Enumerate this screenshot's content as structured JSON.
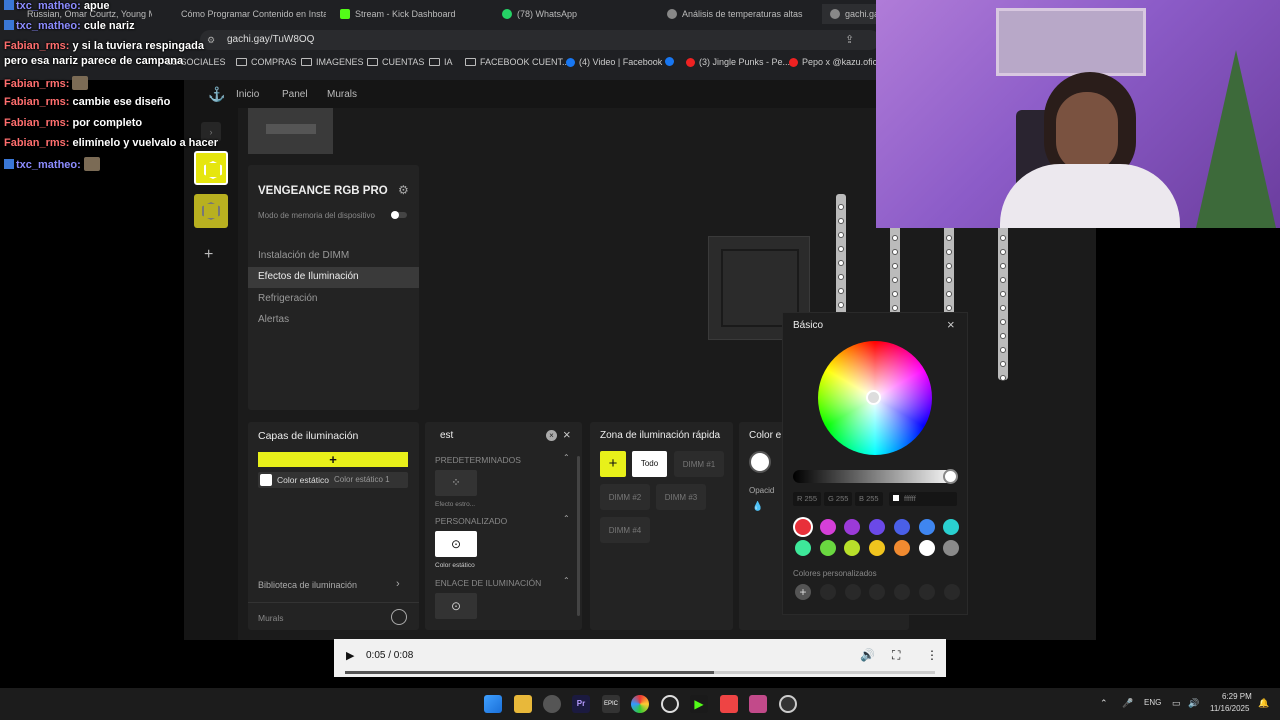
{
  "browser": {
    "tabs": [
      {
        "label": "Russian, Omar Courtz, Young Mi..."
      },
      {
        "label": "Cómo Programar Contenido en Insta..."
      },
      {
        "label": "Stream - Kick Dashboard"
      },
      {
        "label": "(78) WhatsApp"
      },
      {
        "label": "Análisis de temperaturas altas"
      },
      {
        "label": "gachi.ga"
      }
    ],
    "url": "gachi.gay/TuW8OQ",
    "bookmarks": [
      {
        "label": "ES SOCIALES"
      },
      {
        "label": "COMPRAS"
      },
      {
        "label": "IMAGENES"
      },
      {
        "label": "CUENTAS"
      },
      {
        "label": "IA"
      },
      {
        "label": "FACEBOOK CUENT..."
      },
      {
        "label": "(4) Video | Facebook"
      },
      {
        "label": "(3) Jingle Punks - Pe..."
      },
      {
        "label": "Pepo x @kazu.oficia..."
      }
    ]
  },
  "chat": [
    {
      "user": "txc_matheo:",
      "msg": "apue"
    },
    {
      "user": "txc_matheo:",
      "msg": "cule nariz"
    },
    {
      "user": "Fabian_rms:",
      "msg": "y si la tuviera respingada"
    },
    {
      "user": "",
      "msg": "pero esa nariz parece de campana"
    },
    {
      "user": "Fabian_rms:",
      "msg": ""
    },
    {
      "user": "Fabian_rms:",
      "msg": "cambie ese diseño"
    },
    {
      "user": "Fabian_rms:",
      "msg": "por completo"
    },
    {
      "user": "Fabian_rms:",
      "msg": "elimínelo y vuelvalo a hacer"
    },
    {
      "user": "txc_matheo:",
      "msg": ""
    }
  ],
  "app": {
    "nav": {
      "inicio": "Inicio",
      "panel": "Panel",
      "murals": "Murals"
    },
    "device": {
      "name": "VENGEANCE RGB PRO",
      "memory_mode": "Modo de memoria del dispositivo",
      "menu": [
        {
          "label": "Instalación de DIMM"
        },
        {
          "label": "Efectos de Iluminación"
        },
        {
          "label": "Refrigeración"
        },
        {
          "label": "Alertas"
        }
      ]
    },
    "layers": {
      "title": "Capas de iluminación",
      "add": "+",
      "layer_name": "Color estático",
      "layer_value": "Color estático 1",
      "library": "Biblioteca de iluminación",
      "murals": "Murals"
    },
    "effects": {
      "search": "est",
      "predeterminados": "PREDETERMINADOS",
      "effect_label": "Efecto estro...",
      "personalizado": "PERSONALIZADO",
      "static_label": "Color estático",
      "enlace": "ENLACE DE ILUMINACIÓN"
    },
    "zones": {
      "title": "Zona de iluminación rápida",
      "add": "+",
      "all": "Todo",
      "dimm1": "DIMM #1",
      "dimm2": "DIMM #2",
      "dimm3": "DIMM #3",
      "dimm4": "DIMM #4"
    },
    "colorpanel": {
      "title": "Color e",
      "opacity": "Opacid"
    }
  },
  "picker": {
    "title": "Básico",
    "r": "R 255",
    "g": "G 255",
    "b": "B 255",
    "hex": "ffffff",
    "custom_label": "Colores personalizados",
    "add": "+",
    "swatches": [
      "#e8303a",
      "#d63fd8",
      "#9b3ad8",
      "#6b49e8",
      "#4a5fe8",
      "#3f86f0",
      "#2ad0d0",
      "#3ee89a",
      "#6ad840",
      "#b8e02a",
      "#f0c41e",
      "#f08a30",
      "#ffffff",
      "#8a8a8a"
    ]
  },
  "video": {
    "time": "0:05 / 0:08",
    "progress": 0.625
  },
  "taskbar": {
    "lang": "ENG",
    "time": "6:29 PM",
    "date": "11/16/2025"
  }
}
